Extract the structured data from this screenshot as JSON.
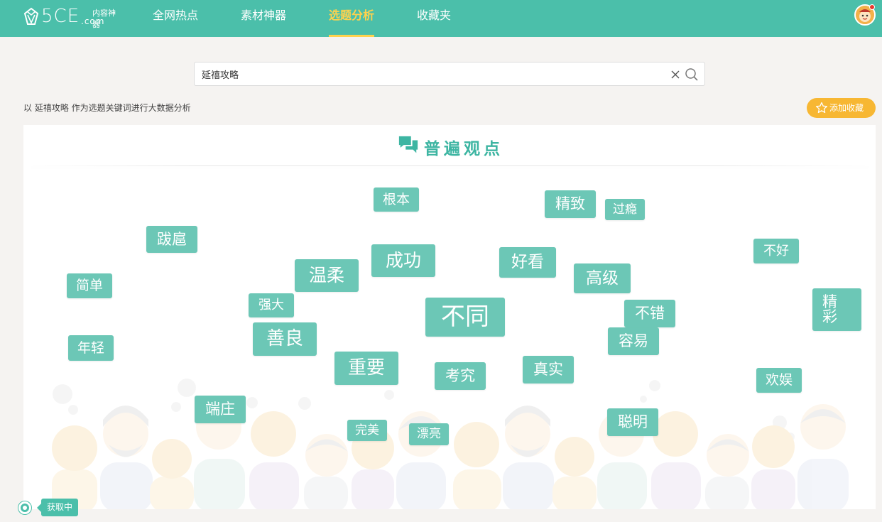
{
  "header": {
    "logo_text": "5CE",
    "logo_com": ".com",
    "logo_tagline": "内容神器",
    "nav": [
      {
        "label": "全网热点",
        "active": false
      },
      {
        "label": "素材神器",
        "active": false
      },
      {
        "label": "选题分析",
        "active": true
      },
      {
        "label": "收藏夹",
        "active": false
      }
    ]
  },
  "search": {
    "value": "延禧攻略",
    "placeholder": ""
  },
  "analysis": {
    "description": "以 延禧攻略 作为选题关键词进行大数据分析",
    "favorite_label": "添加收藏"
  },
  "section": {
    "title": "普遍观点"
  },
  "word_cloud": [
    {
      "word": "根本"
    },
    {
      "word": "精致"
    },
    {
      "word": "过瘾"
    },
    {
      "word": "跋扈"
    },
    {
      "word": "不好"
    },
    {
      "word": "简单"
    },
    {
      "word": "温柔"
    },
    {
      "word": "成功"
    },
    {
      "word": "好看"
    },
    {
      "word": "高级"
    },
    {
      "word": "强大"
    },
    {
      "word": "精彩"
    },
    {
      "word": "不同"
    },
    {
      "word": "不错"
    },
    {
      "word": "善良"
    },
    {
      "word": "容易"
    },
    {
      "word": "年轻"
    },
    {
      "word": "重要"
    },
    {
      "word": "考究"
    },
    {
      "word": "真实"
    },
    {
      "word": "欢娱"
    },
    {
      "word": "端庄"
    },
    {
      "word": "完美"
    },
    {
      "word": "漂亮"
    },
    {
      "word": "聪明"
    }
  ],
  "status": {
    "loading_label": "获取中"
  },
  "colors": {
    "brand": "#4bbfaa",
    "tag": "#6cc7b6",
    "active_nav": "#ffd24d",
    "favorite": "#f7b733"
  }
}
